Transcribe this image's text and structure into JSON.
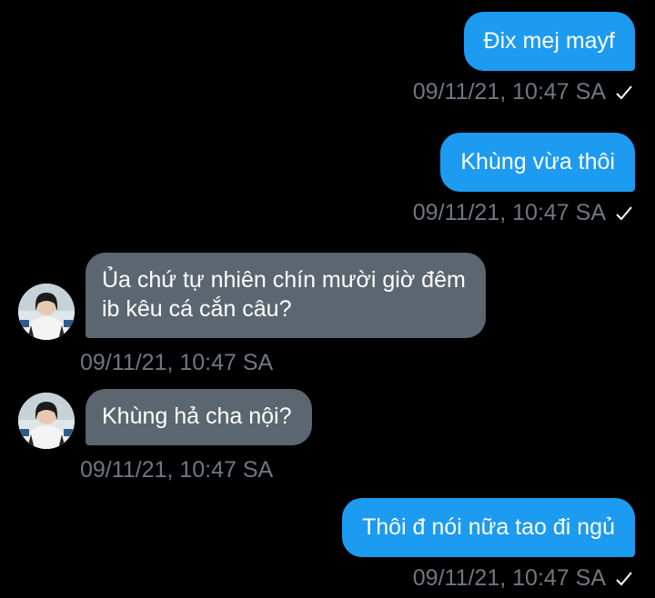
{
  "messages": [
    {
      "direction": "out",
      "text": "Đix mej mayf",
      "timestamp": "09/11/21, 10:47 SA",
      "status_icon": "check-icon"
    },
    {
      "direction": "out",
      "text": "Khùng vừa thôi",
      "timestamp": "09/11/21, 10:47 SA",
      "status_icon": "check-icon"
    },
    {
      "direction": "in",
      "text": "Ủa chứ tự nhiên chín mười giờ đêm\nib kêu cá cắn câu?",
      "timestamp": "09/11/21, 10:47 SA"
    },
    {
      "direction": "in",
      "text": "Khùng hả cha nội?",
      "timestamp": "09/11/21, 10:47 SA"
    },
    {
      "direction": "out",
      "text": "Thôi đ nói nữa tao đi ngủ",
      "timestamp": "09/11/21, 10:47 SA",
      "status_icon": "check-icon"
    }
  ],
  "colors": {
    "background": "#000000",
    "outgoing_bubble": "#1d9bf0",
    "incoming_bubble": "#5b6670",
    "timestamp_text": "#6f7780"
  }
}
